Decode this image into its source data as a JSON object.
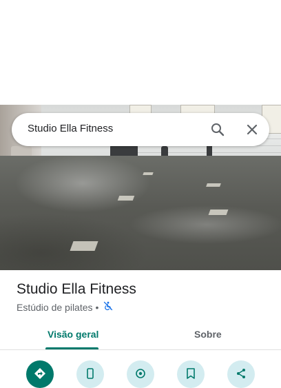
{
  "search": {
    "query": "Studio Ella Fitness",
    "search_icon": "search-icon",
    "clear_icon": "close-icon"
  },
  "place": {
    "name": "Studio Ella Fitness",
    "category": "Estúdio de pilates",
    "separator": "•",
    "accessibility_icon": "wheelchair-not-accessible-icon"
  },
  "tabs": [
    {
      "label": "Visão geral",
      "active": true
    },
    {
      "label": "Sobre",
      "active": false
    }
  ],
  "actions": [
    {
      "icon": "directions-icon",
      "primary": true
    },
    {
      "icon": "phone-icon",
      "primary": false
    },
    {
      "icon": "location-icon",
      "primary": false
    },
    {
      "icon": "save-icon",
      "primary": false
    },
    {
      "icon": "share-icon",
      "primary": false
    }
  ],
  "colors": {
    "accent": "#00796b",
    "secondary_button": "#d3ecf0",
    "accessibility_icon": "#1a73e8"
  }
}
